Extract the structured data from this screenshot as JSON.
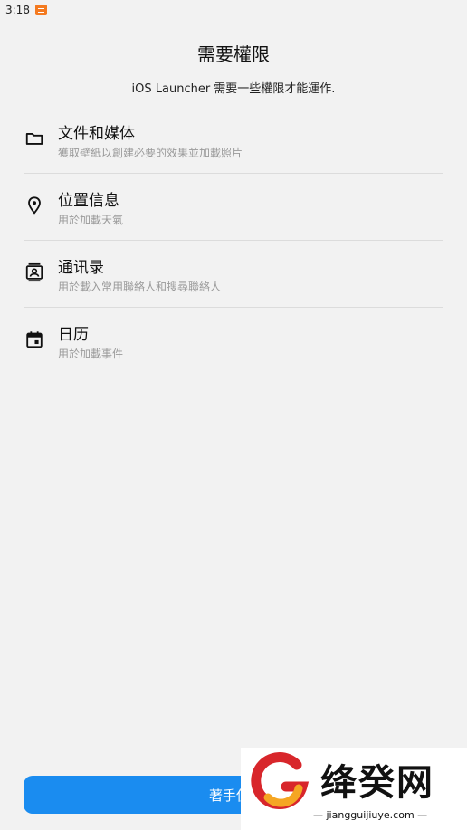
{
  "status_bar": {
    "time": "3:18",
    "app_icon": "notification-app-icon"
  },
  "header": {
    "title": "需要權限",
    "subtitle": "iOS Launcher 需要一些權限才能運作."
  },
  "permissions": [
    {
      "icon": "folder-icon",
      "title": "文件和媒体",
      "desc": "獲取壁紙以創建必要的效果並加載照片"
    },
    {
      "icon": "location-pin-icon",
      "title": "位置信息",
      "desc": "用於加載天氣"
    },
    {
      "icon": "contacts-icon",
      "title": "通讯录",
      "desc": "用於載入常用聯絡人和搜尋聯絡人"
    },
    {
      "icon": "calendar-icon",
      "title": "日历",
      "desc": "用於加載事件"
    }
  ],
  "start_button": {
    "label": "著手使用"
  },
  "watermark": {
    "text": "绛癸网",
    "url": "jiangguijiuye.com"
  },
  "colors": {
    "accent": "#1a8cf0",
    "background": "#f2f2f2",
    "watermark_red": "#d8262b",
    "watermark_orange": "#f5a623"
  }
}
